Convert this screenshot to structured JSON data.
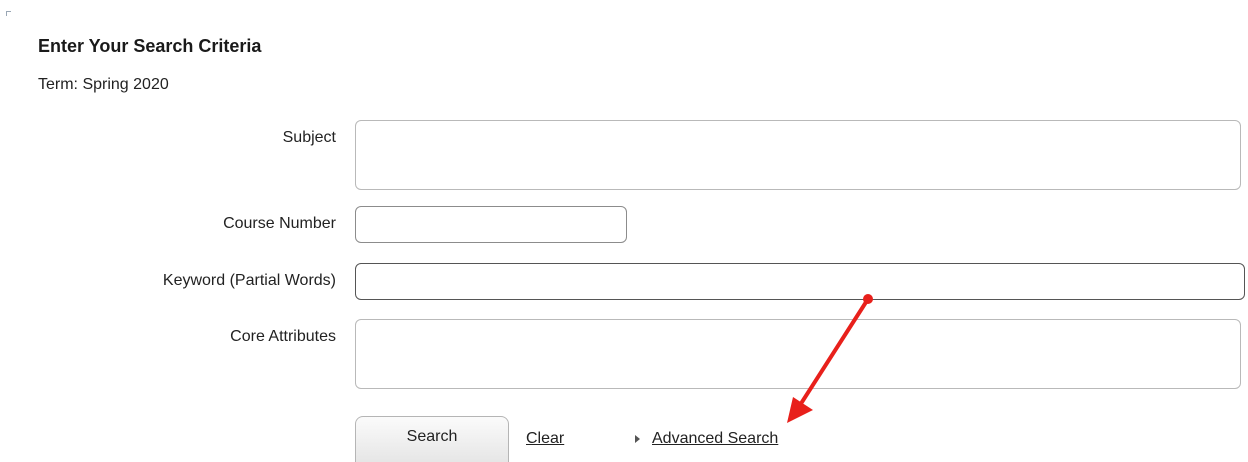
{
  "header": {
    "title": "Enter Your Search Criteria",
    "term": "Term: Spring 2020"
  },
  "form": {
    "subject": {
      "label": "Subject",
      "value": ""
    },
    "course_number": {
      "label": "Course Number",
      "value": ""
    },
    "keyword": {
      "label": "Keyword (Partial Words)",
      "value": ""
    },
    "core_attributes": {
      "label": "Core Attributes",
      "value": ""
    }
  },
  "actions": {
    "search_label": "Search",
    "clear_label": "Clear",
    "advanced_label": "Advanced Search"
  },
  "annotation": {
    "arrow_color": "#e8201b"
  },
  "icons": {
    "advanced_toggle": "caret-right-icon",
    "annotation": "red-arrow-icon"
  }
}
